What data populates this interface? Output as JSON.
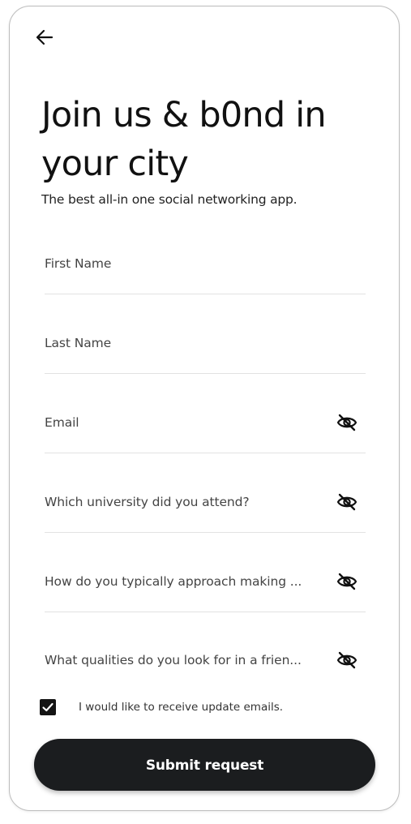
{
  "header": {
    "back_icon": "arrow-left-icon",
    "title": "Join us & b0nd in your city",
    "subtitle": "The best all-in one social networking app."
  },
  "form": {
    "fields": [
      {
        "placeholder": "First Name",
        "has_visibility_toggle": false
      },
      {
        "placeholder": "Last Name",
        "has_visibility_toggle": false
      },
      {
        "placeholder": "Email",
        "has_visibility_toggle": true,
        "icon": "eye-off-icon"
      },
      {
        "placeholder": "Which university did you attend?",
        "has_visibility_toggle": true,
        "icon": "eye-off-icon"
      },
      {
        "placeholder": "How do you typically approach making ...",
        "has_visibility_toggle": true,
        "icon": "eye-off-icon"
      },
      {
        "placeholder": "What qualities do you look for in a frien...",
        "has_visibility_toggle": true,
        "icon": "eye-off-icon"
      }
    ],
    "updates_checkbox": {
      "label": "I would like to receive update emails.",
      "checked": true
    },
    "submit_label": "Submit request"
  },
  "colors": {
    "primary_button": "#1b1d1f",
    "divider": "#e2e2e2",
    "text": "#111111"
  }
}
